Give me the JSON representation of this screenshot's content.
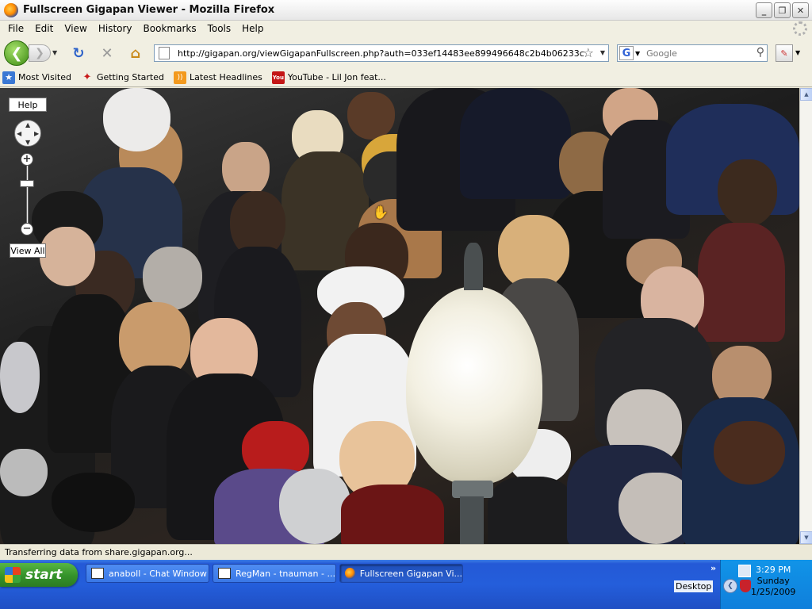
{
  "window": {
    "title": "Fullscreen Gigapan Viewer - Mozilla Firefox",
    "minimize": "_",
    "maximize": "❐",
    "close": "✕"
  },
  "menu": [
    "File",
    "Edit",
    "View",
    "History",
    "Bookmarks",
    "Tools",
    "Help"
  ],
  "nav": {
    "url": "http://gigapan.org/viewGigapanFullscreen.php?auth=033ef14483ee899496648c2b4b06233c",
    "search_placeholder": "Google"
  },
  "bookmarks": [
    "Most Visited",
    "Getting Started",
    "Latest Headlines",
    "YouTube - Lil Jon feat..."
  ],
  "viewer": {
    "help_label": "Help",
    "view_all_label": "View All",
    "zoom_in": "+",
    "zoom_out": "−"
  },
  "status": "Transferring data from share.gigapan.org...",
  "taskbar": {
    "start_label": "start",
    "tasks": [
      "anaboll - Chat Window",
      "RegMan - tnauman - ...",
      "Fullscreen Gigapan Vi..."
    ],
    "desktop_label": "Desktop",
    "time": "3:29 PM",
    "day": "Sunday",
    "date": "1/25/2009"
  }
}
